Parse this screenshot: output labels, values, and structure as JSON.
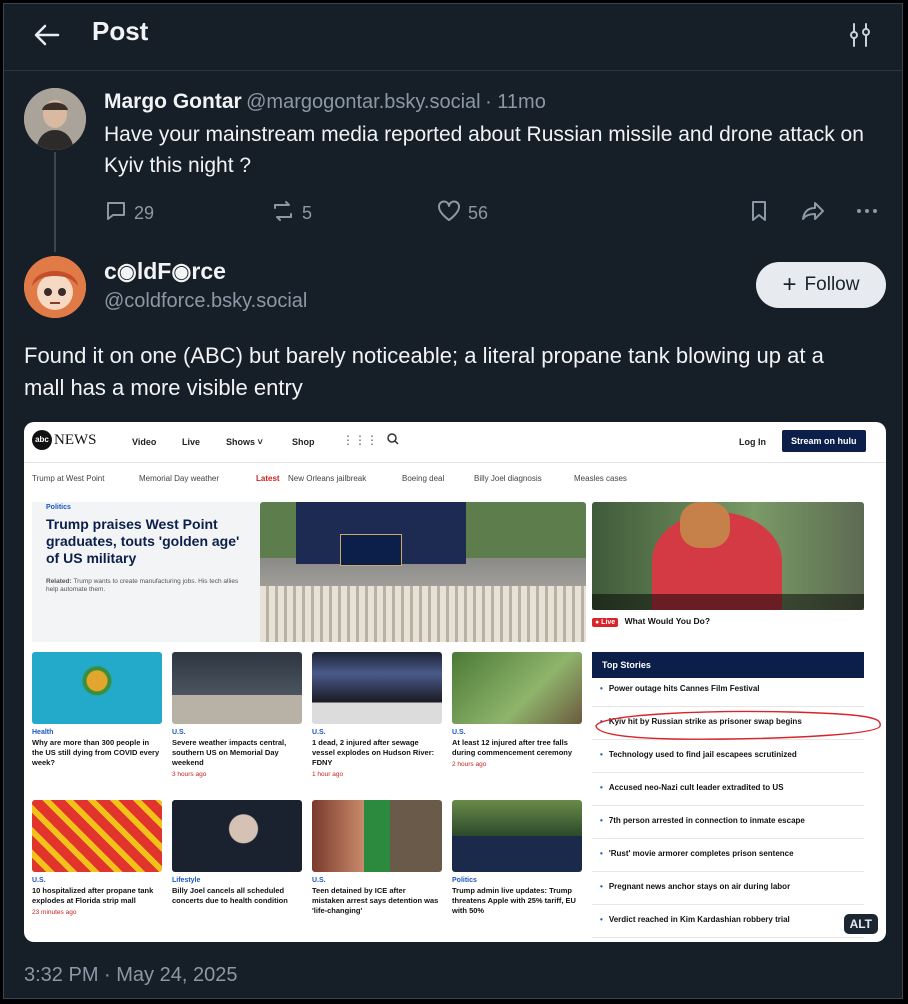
{
  "header": {
    "title": "Post"
  },
  "post1": {
    "author_name": "Margo Gontar",
    "author_handle": "@margogontar.bsky.social",
    "age": "· 11mo",
    "text": "Have your mainstream media reported about Russian missile and drone attack on Kyiv this night ?",
    "replies": "29",
    "reposts": "5",
    "likes": "56"
  },
  "post2": {
    "author_name": "c◉ldF◉rce",
    "author_handle": "@coldforce.bsky.social",
    "follow_label": "Follow",
    "text": "Found it on one (ABC) but barely noticeable; a literal propane tank blowing up at a mall has a more visible entry",
    "timestamp": "3:32 PM · May 24, 2025",
    "alt_label": "ALT"
  },
  "screenshot": {
    "logo": "NEWS",
    "nav": [
      "Video",
      "Live",
      "Shows ˅",
      "Shop"
    ],
    "login": "Log In",
    "stream": "Stream on hulu",
    "subnav": [
      "Trump at West Point",
      "Memorial Day weather",
      "Latest",
      "New Orleans jailbreak",
      "Boeing deal",
      "Billy Joel diagnosis",
      "Measles cases"
    ],
    "hero_tag": "Politics",
    "hero_title": "Trump praises West Point graduates, touts 'golden age' of US military",
    "hero_related_label": "Related:",
    "hero_related": "Trump wants to create manufacturing jobs. His tech allies help automate them.",
    "live_badge": "● Live",
    "live_title": "What Would You Do?",
    "top_stories_title": "Top Stories",
    "top_stories": [
      "Power outage hits Cannes Film Festival",
      "Kyiv hit by Russian strike as prisoner swap begins",
      "Technology used to find jail escapees scrutinized",
      "Accused neo-Nazi cult leader extradited to US",
      "7th person arrested in connection to inmate escape",
      "'Rust' movie armorer completes prison sentence",
      "Pregnant news anchor stays on air during labor",
      "Verdict reached in Kim Kardashian robbery trial"
    ],
    "cards_row1": [
      {
        "tag": "Health",
        "title": "Why are more than 300 people in the US still dying from COVID every week?",
        "ago": ""
      },
      {
        "tag": "U.S.",
        "title": "Severe weather impacts central, southern US on Memorial Day weekend",
        "ago": "3 hours ago"
      },
      {
        "tag": "U.S.",
        "title": "1 dead, 2 injured after sewage vessel explodes on Hudson River: FDNY",
        "ago": "1 hour ago"
      },
      {
        "tag": "U.S.",
        "title": "At least 12 injured after tree falls during commencement ceremony",
        "ago": "2 hours ago"
      }
    ],
    "cards_row2": [
      {
        "tag": "U.S.",
        "title": "10 hospitalized after propane tank explodes at Florida strip mall",
        "ago": "23 minutes ago"
      },
      {
        "tag": "Lifestyle",
        "title": "Billy Joel cancels all scheduled concerts due to health condition",
        "ago": ""
      },
      {
        "tag": "U.S.",
        "title": "Teen detained by ICE after mistaken arrest says detention was 'life-changing'",
        "ago": ""
      },
      {
        "tag": "Politics",
        "title": "Trump admin live updates: Trump threatens Apple with 25% tariff, EU with 50%",
        "ago": ""
      }
    ]
  },
  "colors": {
    "background": "#161e27",
    "text": "#f1f3f5",
    "muted": "#8b98a5",
    "abc_navy": "#0b1f4a",
    "annotation_red": "#d8242a"
  },
  "icons": [
    "back-arrow-icon",
    "sliders-icon",
    "reply-icon",
    "repost-icon",
    "like-icon",
    "bookmark-icon",
    "share-icon",
    "more-icon",
    "plus-icon"
  ]
}
